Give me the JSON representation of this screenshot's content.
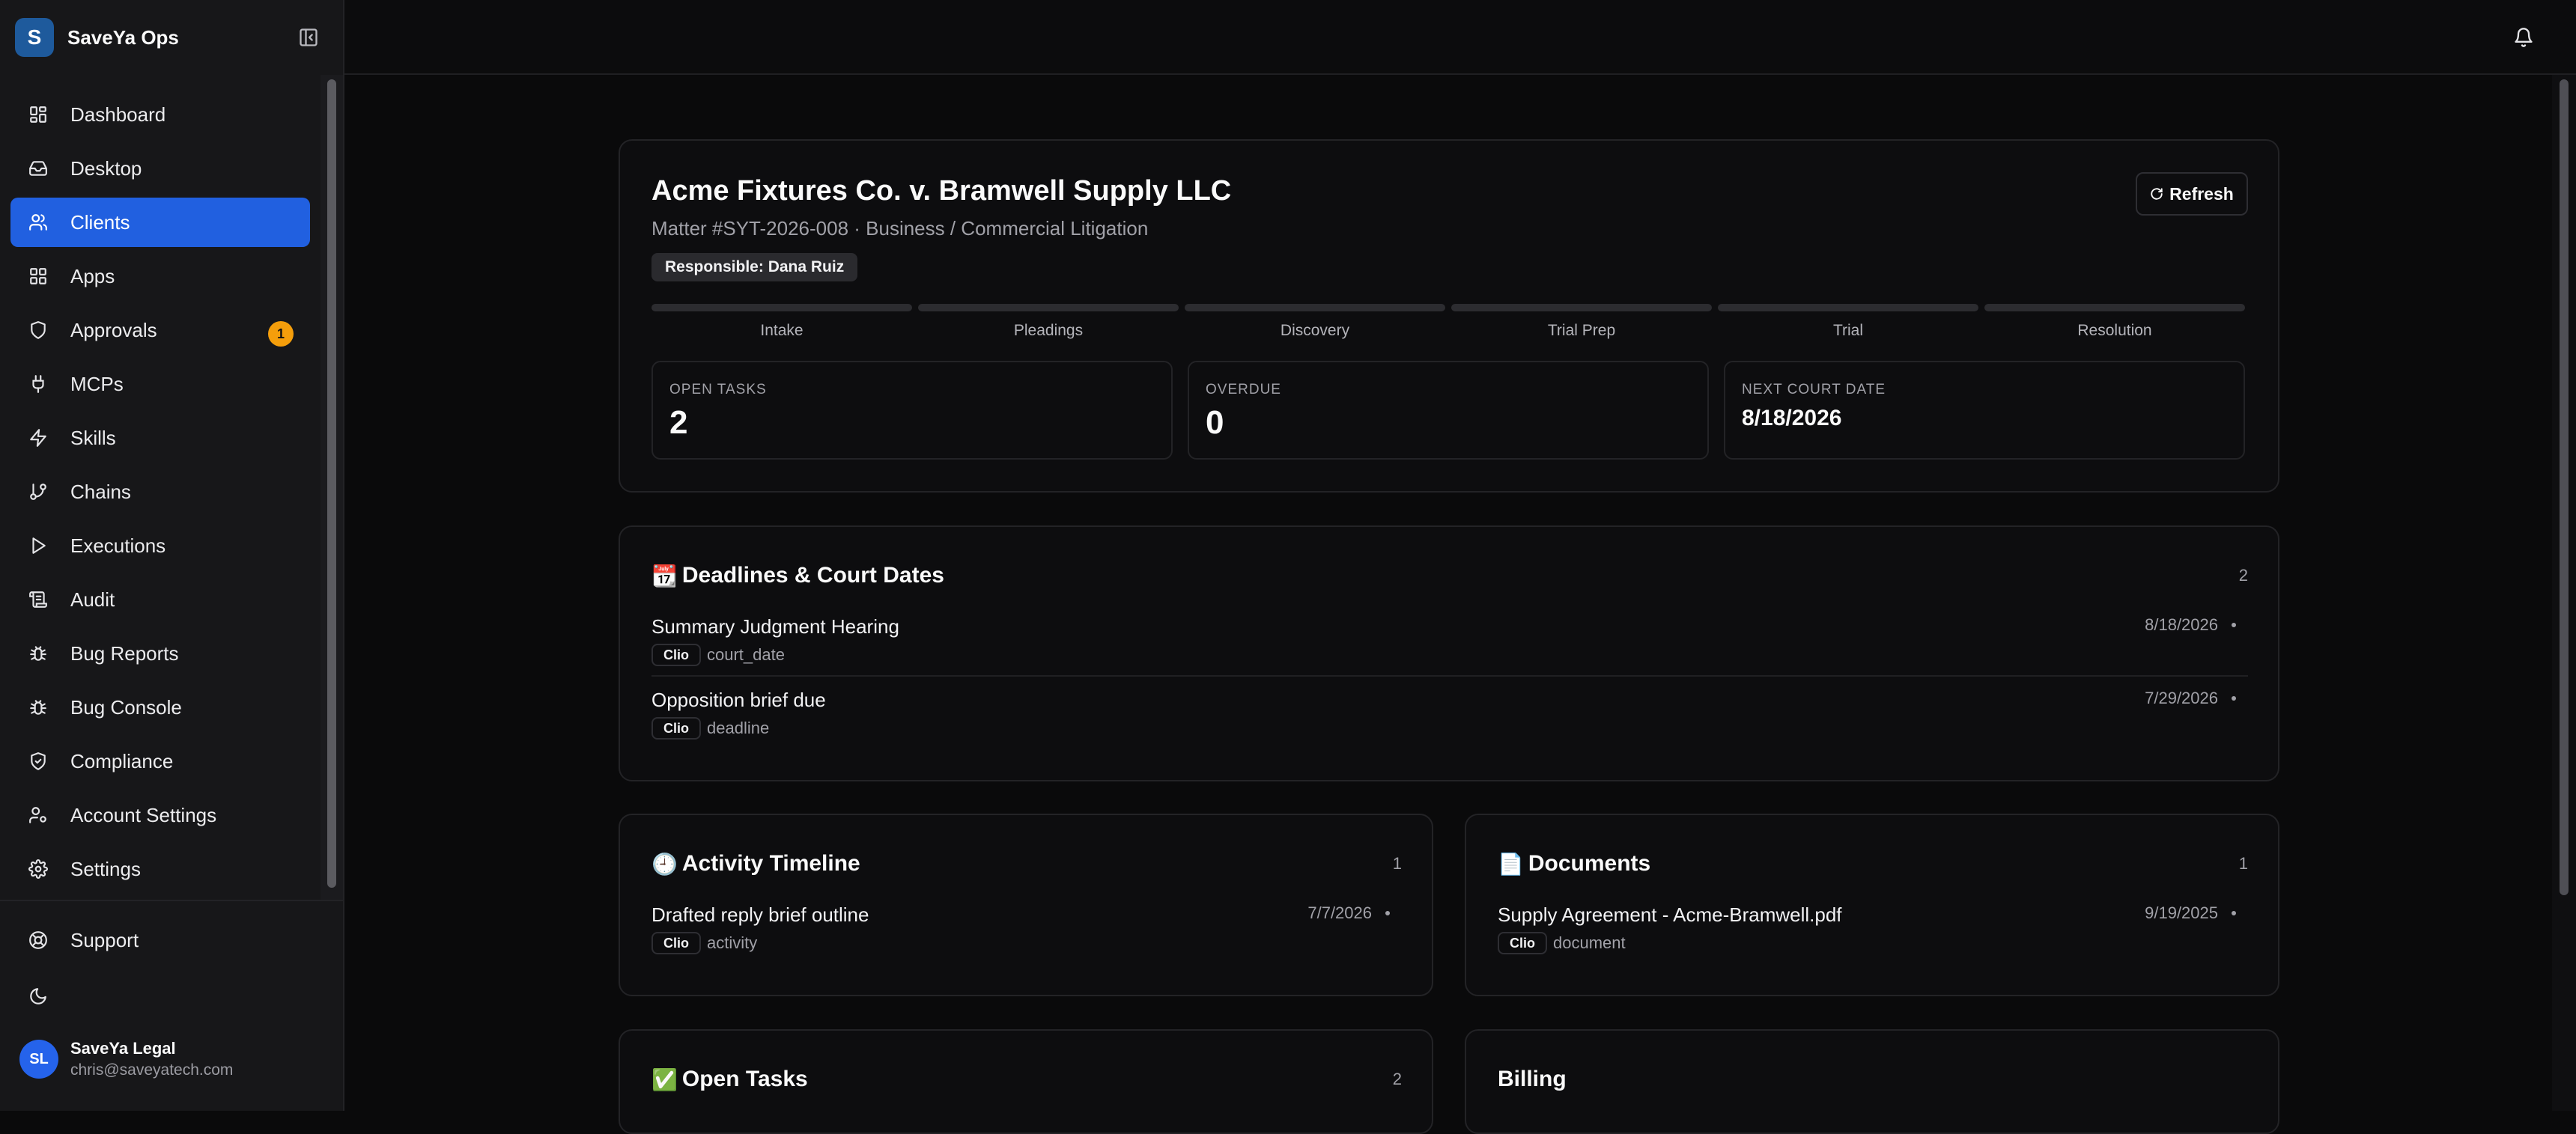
{
  "app": {
    "name": "SaveYa Ops",
    "logo_letter": "S"
  },
  "sidebar": {
    "items": [
      {
        "label": "Dashboard",
        "icon": "dashboard-icon"
      },
      {
        "label": "Desktop",
        "icon": "inbox-icon"
      },
      {
        "label": "Clients",
        "icon": "users-icon",
        "active": true
      },
      {
        "label": "Apps",
        "icon": "grid-icon"
      },
      {
        "label": "Approvals",
        "icon": "shield-icon",
        "badge": "1"
      },
      {
        "label": "MCPs",
        "icon": "plug-icon"
      },
      {
        "label": "Skills",
        "icon": "bolt-icon"
      },
      {
        "label": "Chains",
        "icon": "branch-icon"
      },
      {
        "label": "Executions",
        "icon": "play-icon"
      },
      {
        "label": "Audit",
        "icon": "scroll-icon"
      },
      {
        "label": "Bug Reports",
        "icon": "bug-icon"
      },
      {
        "label": "Bug Console",
        "icon": "bug-icon"
      },
      {
        "label": "Compliance",
        "icon": "shield-check-icon"
      },
      {
        "label": "Account Settings",
        "icon": "user-cog-icon"
      },
      {
        "label": "Settings",
        "icon": "gear-icon"
      }
    ],
    "support_label": "Support",
    "user": {
      "initials": "SL",
      "name": "SaveYa Legal",
      "email": "chris@saveyatech.com"
    }
  },
  "matter": {
    "title": "Acme Fixtures Co. v. Bramwell Supply LLC",
    "subtitle": "Matter #SYT-2026-008 · Business / Commercial Litigation",
    "responsible": "Responsible: Dana Ruiz",
    "refresh_label": "Refresh",
    "stages": [
      "Intake",
      "Pleadings",
      "Discovery",
      "Trial Prep",
      "Trial",
      "Resolution"
    ],
    "stats": [
      {
        "label": "OPEN TASKS",
        "value": "2"
      },
      {
        "label": "OVERDUE",
        "value": "0"
      },
      {
        "label": "NEXT COURT DATE",
        "value": "8/18/2026"
      }
    ]
  },
  "deadlines": {
    "emoji": "📆",
    "title": "Deadlines & Court Dates",
    "count": "2",
    "rows": [
      {
        "title": "Summary Judgment Hearing",
        "source": "Clio",
        "kind": "court_date",
        "date": "8/18/2026"
      },
      {
        "title": "Opposition brief due",
        "source": "Clio",
        "kind": "deadline",
        "date": "7/29/2026"
      }
    ]
  },
  "activity": {
    "emoji": "🕘",
    "title": "Activity Timeline",
    "count": "1",
    "rows": [
      {
        "title": "Drafted reply brief outline",
        "source": "Clio",
        "kind": "activity",
        "date": "7/7/2026"
      }
    ]
  },
  "documents": {
    "emoji": "📄",
    "title": "Documents",
    "count": "1",
    "rows": [
      {
        "title": "Supply Agreement - Acme-Bramwell.pdf",
        "source": "Clio",
        "kind": "document",
        "date": "9/19/2025"
      }
    ]
  },
  "open_tasks": {
    "emoji": "✅",
    "title": "Open Tasks",
    "count": "2"
  },
  "billing": {
    "title": "Billing"
  }
}
